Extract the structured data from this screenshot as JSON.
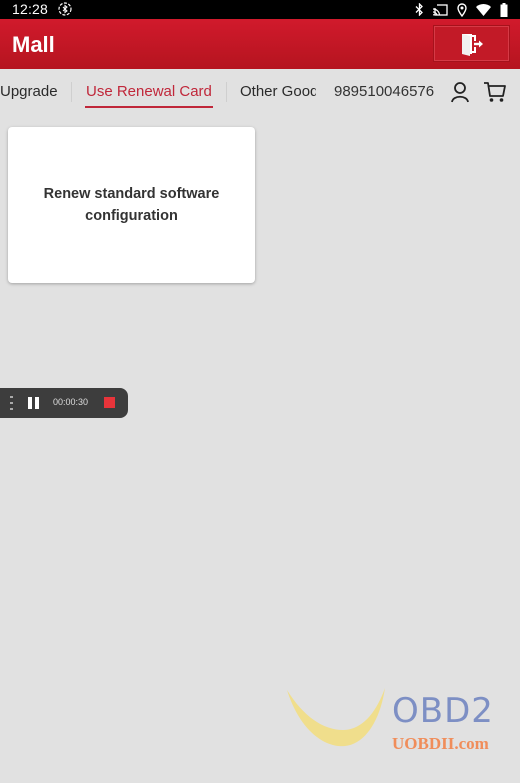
{
  "status_bar": {
    "time": "12:28",
    "left_icon": "bluetooth-circle-icon",
    "right_icons": [
      "bluetooth-icon",
      "cast-icon",
      "location-icon",
      "wifi-icon",
      "battery-icon"
    ]
  },
  "app_bar": {
    "title": "Mall",
    "exit_icon": "exit-door-icon",
    "color": "#c8172a"
  },
  "tabs": [
    {
      "label": "Upgrade",
      "visible_text": "pgrade",
      "active": false
    },
    {
      "label": "Use Renewal Card",
      "active": true
    },
    {
      "label": "Other Goods",
      "visible_text": "Other Gooc",
      "active": false
    }
  ],
  "account": {
    "number": "989510046576",
    "user_icon": "user-icon",
    "cart_icon": "cart-icon"
  },
  "cards": [
    {
      "title": "Renew standard software configuration"
    }
  ],
  "recorder": {
    "elapsed": "00:00:30",
    "pause_icon": "pause-icon",
    "stop_icon": "stop-icon"
  },
  "watermark": {
    "brand": "OBD2",
    "url": "UOBDII.com"
  },
  "colors": {
    "accent": "#c0273a",
    "background": "#e1e1e1"
  }
}
